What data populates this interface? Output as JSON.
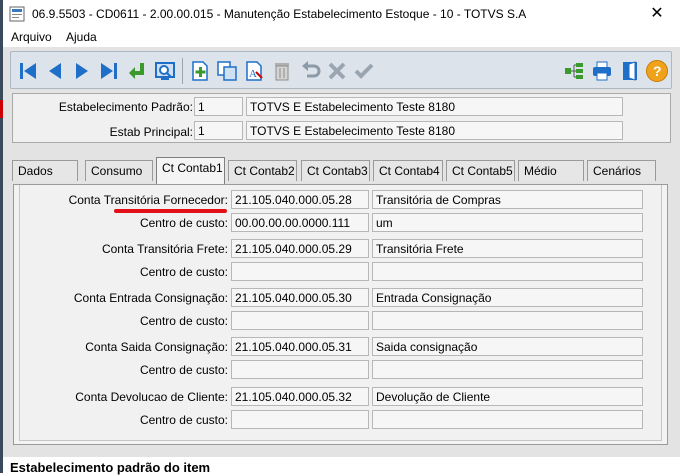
{
  "window": {
    "title": "06.9.5503 - CD0611 - 2.00.00.015 - Manutenção Estabelecimento Estoque - 10 - TOTVS S.A",
    "close_glyph": "✕"
  },
  "menu": [
    "Arquivo",
    "Ajuda"
  ],
  "toolbar": {
    "buttons": [
      "first-icon",
      "previous-icon",
      "next-icon",
      "last-icon",
      "goto-icon",
      "search-icon",
      "add-icon",
      "copy-icon",
      "edit-icon",
      "delete-icon",
      "undo-icon",
      "cancel-icon",
      "confirm-icon",
      "tree-icon",
      "print-icon",
      "exit-icon",
      "help-icon"
    ]
  },
  "header": {
    "estab_padrao": {
      "label": "Estabelecimento Padrão:",
      "code": "1",
      "name": "TOTVS E Estabelecimento Teste 8180"
    },
    "estab_principal": {
      "label": "Estab Principal:",
      "code": "1",
      "name": "TOTVS E Estabelecimento Teste 8180"
    }
  },
  "tabs": [
    "Dados",
    "Consumo",
    "Ct Contab1",
    "Ct Contab2",
    "Ct Contab3",
    "Ct Contab4",
    "Ct Contab5",
    "Médio",
    "Cenários"
  ],
  "active_tab": "Ct Contab1",
  "rows": [
    {
      "label": "Conta Transitória Fornecedor:",
      "account": "21.105.040.000.05.28",
      "description": "Transitória de Compras"
    },
    {
      "label": "Centro de custo:",
      "account": "00.00.00.00.0000.111",
      "description": "um"
    },
    {
      "label": "Conta Transitória Frete:",
      "account": "21.105.040.000.05.29",
      "description": "Transitória Frete"
    },
    {
      "label": "Centro de custo:",
      "account": "",
      "description": ""
    },
    {
      "label": "Conta Entrada Consignação:",
      "account": "21.105.040.000.05.30",
      "description": "Entrada Consignação"
    },
    {
      "label": "Centro de custo:",
      "account": "",
      "description": ""
    },
    {
      "label": "Conta Saida Consignação:",
      "account": "21.105.040.000.05.31",
      "description": "Saida consignação"
    },
    {
      "label": "Centro de custo:",
      "account": "",
      "description": ""
    },
    {
      "label": "Conta Devolucao de Cliente:",
      "account": "21.105.040.000.05.32",
      "description": "Devolução de Cliente"
    },
    {
      "label": "Centro de custo:",
      "account": "",
      "description": ""
    }
  ],
  "status": "Estabelecimento padrão do item",
  "colors": {
    "underline": "#e3101a",
    "toolbar_blue": "#1f6fc9",
    "help_orange": "#f0a21b"
  }
}
